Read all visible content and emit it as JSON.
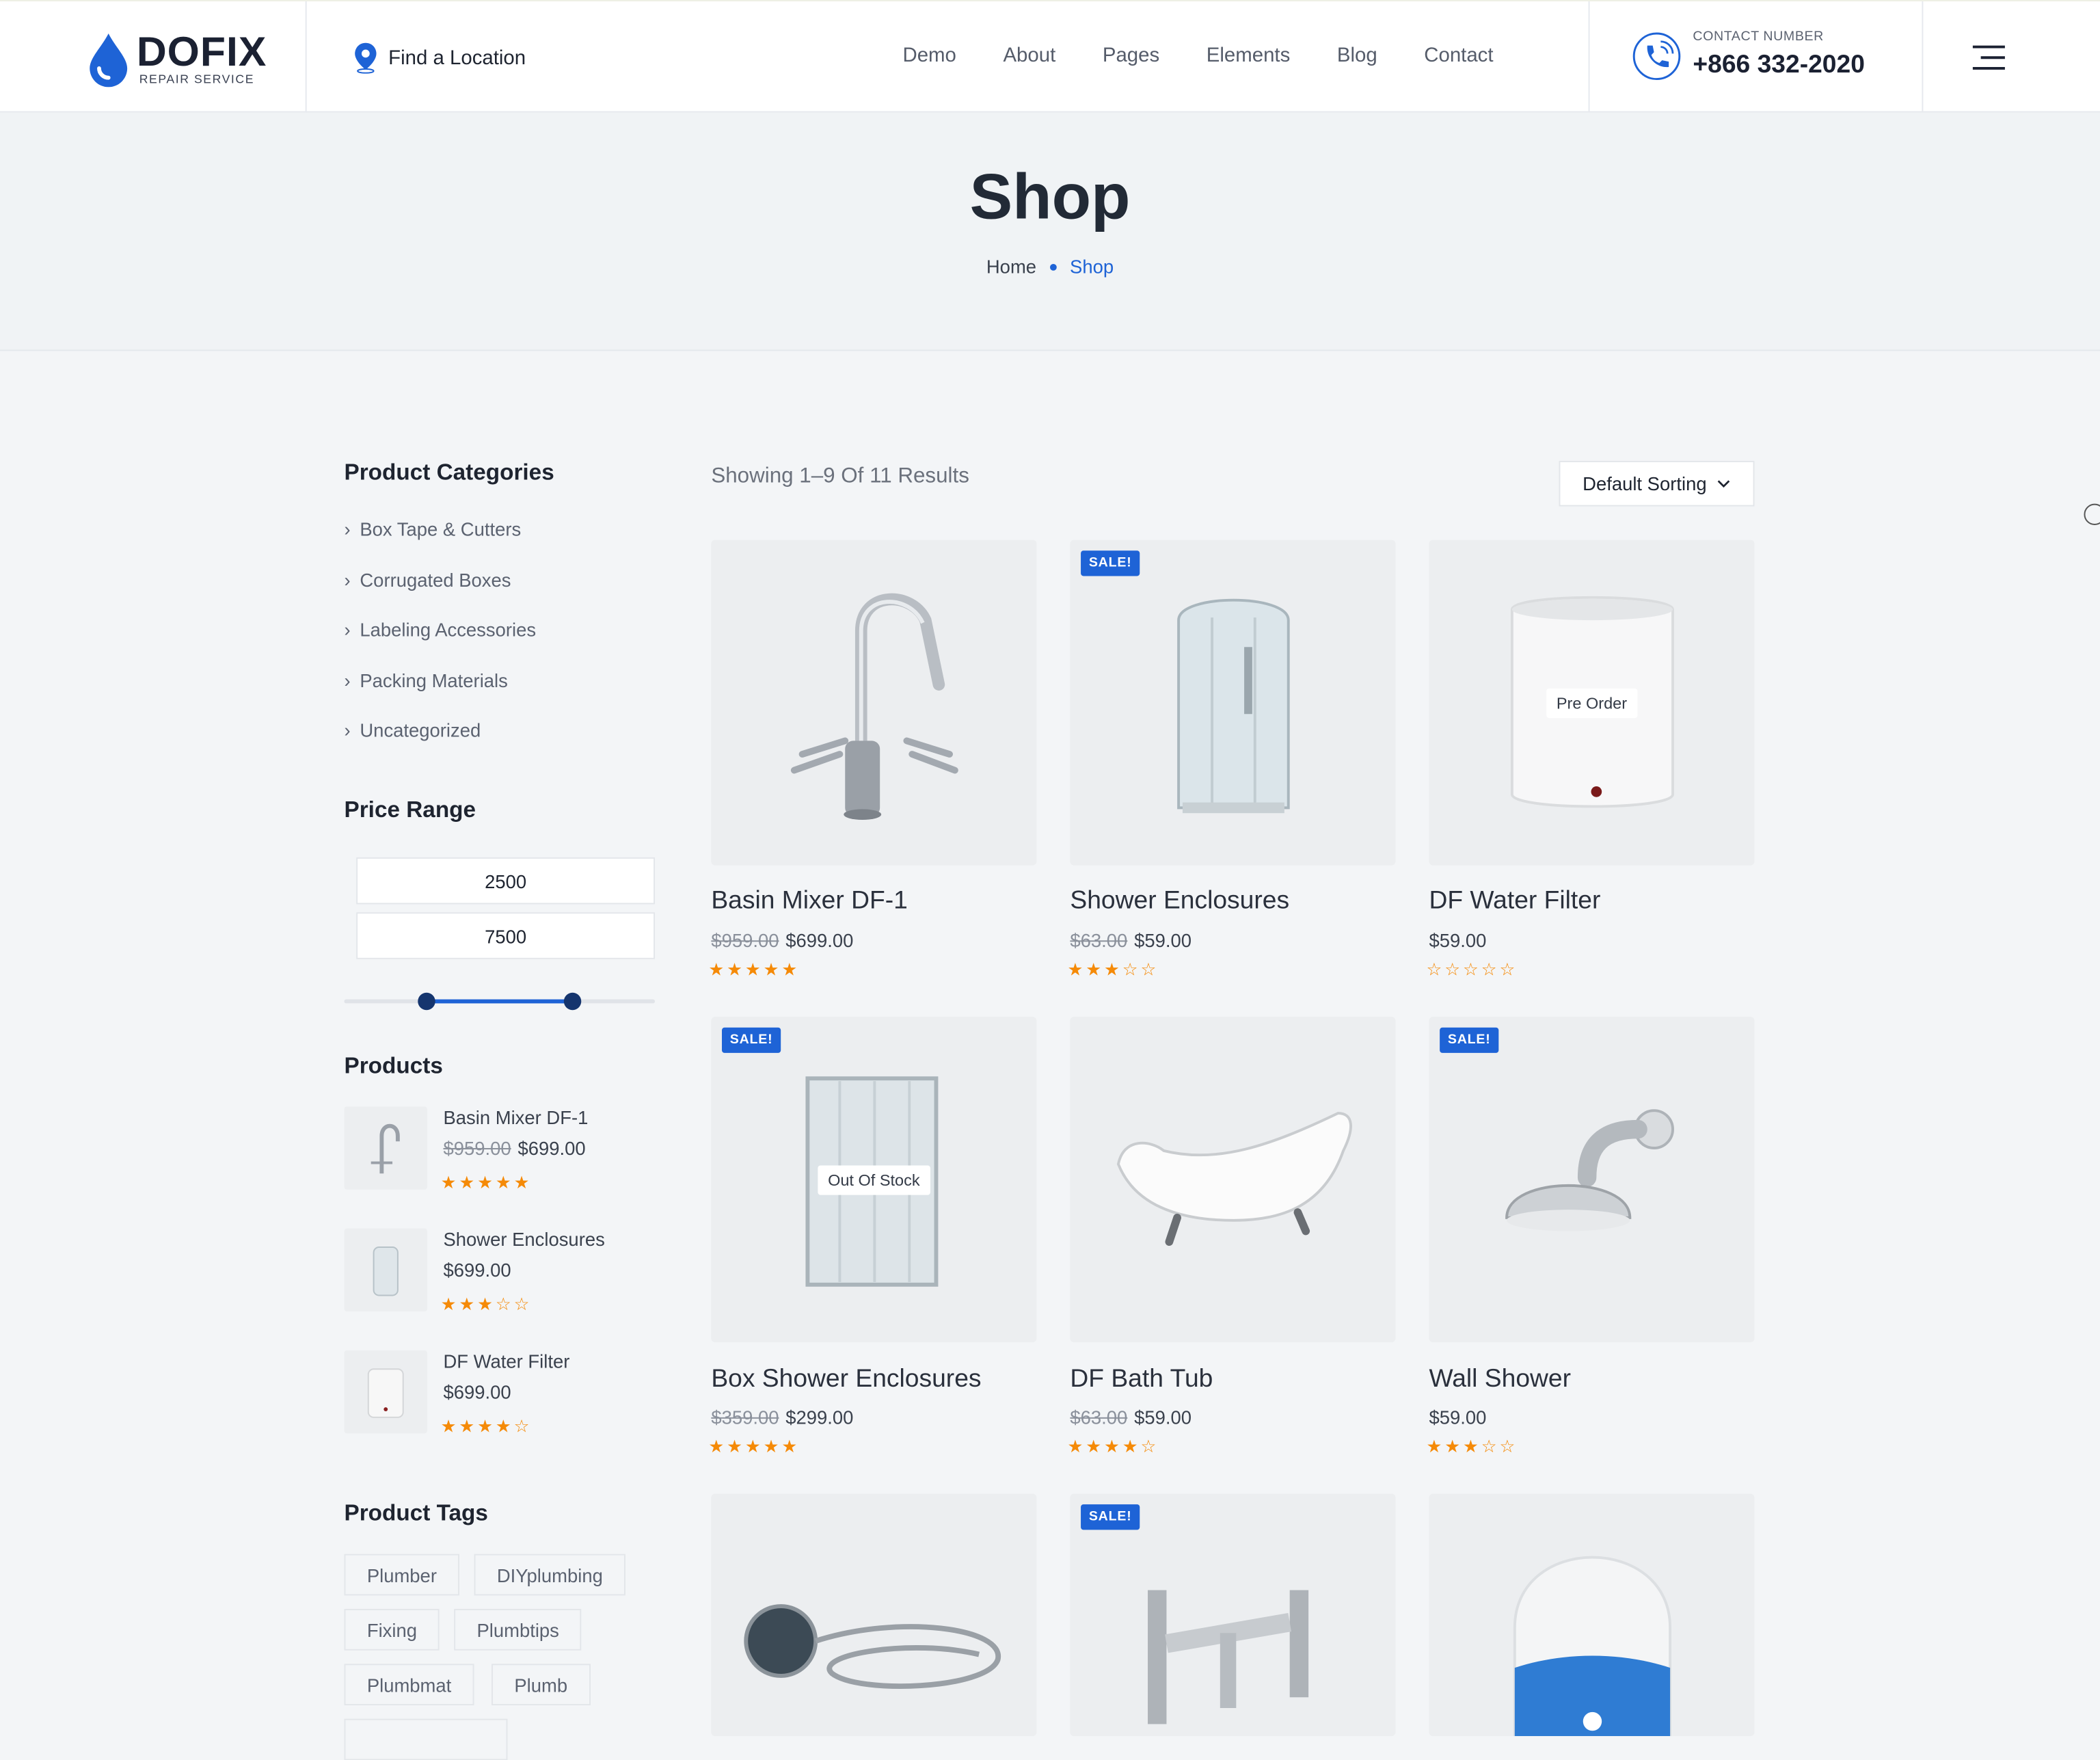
{
  "header": {
    "logo_name": "DOFIX",
    "logo_sub": "REPAIR SERVICE",
    "find_location": "Find a Location",
    "nav": [
      "Demo",
      "About",
      "Pages",
      "Elements",
      "Blog",
      "Contact"
    ],
    "contact_label": "CONTACT NUMBER",
    "contact_number": "+866 332-2020"
  },
  "hero": {
    "title": "Shop",
    "breadcrumb_home": "Home",
    "breadcrumb_current": "Shop"
  },
  "sidebar": {
    "categories_title": "Product Categories",
    "categories": [
      "Box Tape & Cutters",
      "Corrugated Boxes",
      "Labeling Accessories",
      "Packing Materials",
      "Uncategorized"
    ],
    "price_title": "Price Range",
    "price_min": "2500",
    "price_max": "7500",
    "products_title": "Products",
    "products": [
      {
        "name": "Basin Mixer DF-1",
        "old_price": "$959.00",
        "price": "$699.00",
        "stars": "★★★★★"
      },
      {
        "name": "Shower Enclosures",
        "old_price": "",
        "price": "$699.00",
        "stars": "★★★☆☆"
      },
      {
        "name": "DF Water Filter",
        "old_price": "",
        "price": "$699.00",
        "stars": "★★★★☆"
      }
    ],
    "tags_title": "Product Tags",
    "tags": [
      "Plumber",
      "DIYplumbing",
      "Fixing",
      "Plumbtips",
      "Plumbmat",
      "Plumb"
    ]
  },
  "main": {
    "results_text": "Showing 1–9 Of 11 Results",
    "sorting": "Default Sorting",
    "sale_label": "SALE!",
    "products": [
      {
        "name": "Basin Mixer DF-1",
        "old_price": "$959.00",
        "price": "$699.00",
        "stars": "★★★★★",
        "sale": false,
        "overlay": ""
      },
      {
        "name": "Shower Enclosures",
        "old_price": "$63.00",
        "price": "$59.00",
        "stars": "★★★☆☆",
        "sale": true,
        "overlay": ""
      },
      {
        "name": "DF Water Filter",
        "old_price": "",
        "price": "$59.00",
        "stars": "☆☆☆☆☆",
        "sale": false,
        "overlay": "Pre Order"
      },
      {
        "name": "Box Shower Enclosures",
        "old_price": "$359.00",
        "price": "$299.00",
        "stars": "★★★★★",
        "sale": true,
        "overlay": "Out Of Stock"
      },
      {
        "name": "DF Bath Tub",
        "old_price": "$63.00",
        "price": "$59.00",
        "stars": "★★★★☆",
        "sale": false,
        "overlay": ""
      },
      {
        "name": "Wall Shower",
        "old_price": "",
        "price": "$59.00",
        "stars": "★★★☆☆",
        "sale": true,
        "overlay": ""
      },
      {
        "sale": false
      },
      {
        "sale": true
      },
      {
        "sale": false
      }
    ]
  },
  "colors": {
    "accent": "#1e63d6",
    "star": "#f58a07",
    "sale_badge": "#1e63d6"
  }
}
